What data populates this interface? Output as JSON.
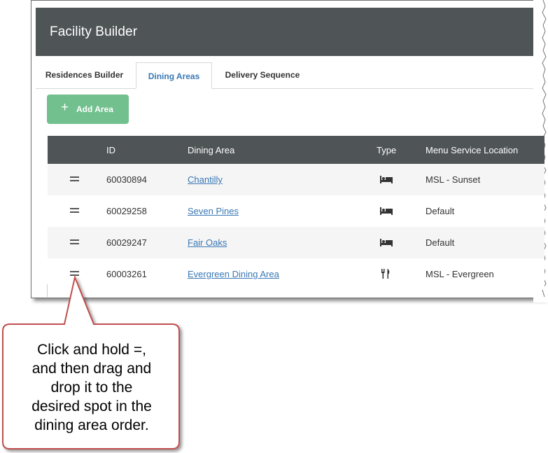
{
  "app": {
    "title": "Facility Builder"
  },
  "tabs": [
    {
      "label": "Residences Builder",
      "active": false
    },
    {
      "label": "Dining Areas",
      "active": true
    },
    {
      "label": "Delivery Sequence",
      "active": false
    }
  ],
  "toolbar": {
    "add_icon": "+",
    "add_label": "Add Area"
  },
  "table": {
    "columns": [
      "ID",
      "Dining Area",
      "Type",
      "Menu Service Location"
    ],
    "rows": [
      {
        "id": "60030894",
        "name": "Chantilly",
        "type_icon": "bed-icon",
        "location": "MSL - Sunset"
      },
      {
        "id": "60029258",
        "name": "Seven Pines",
        "type_icon": "bed-icon",
        "location": "Default"
      },
      {
        "id": "60029247",
        "name": "Fair Oaks",
        "type_icon": "bed-icon",
        "location": "Default"
      },
      {
        "id": "60003261",
        "name": "Evergreen Dining Area",
        "type_icon": "fork-knife-icon",
        "location": "MSL - Evergreen"
      }
    ]
  },
  "callout": {
    "lines": [
      "Click and hold =,",
      "and then drag and",
      "drop it to the",
      "desired spot in the",
      "dining area order."
    ]
  },
  "colors": {
    "header": "#4f5456",
    "accent_link": "#3a78b5",
    "add_button": "#71c08d",
    "callout_border": "#c0504d"
  }
}
